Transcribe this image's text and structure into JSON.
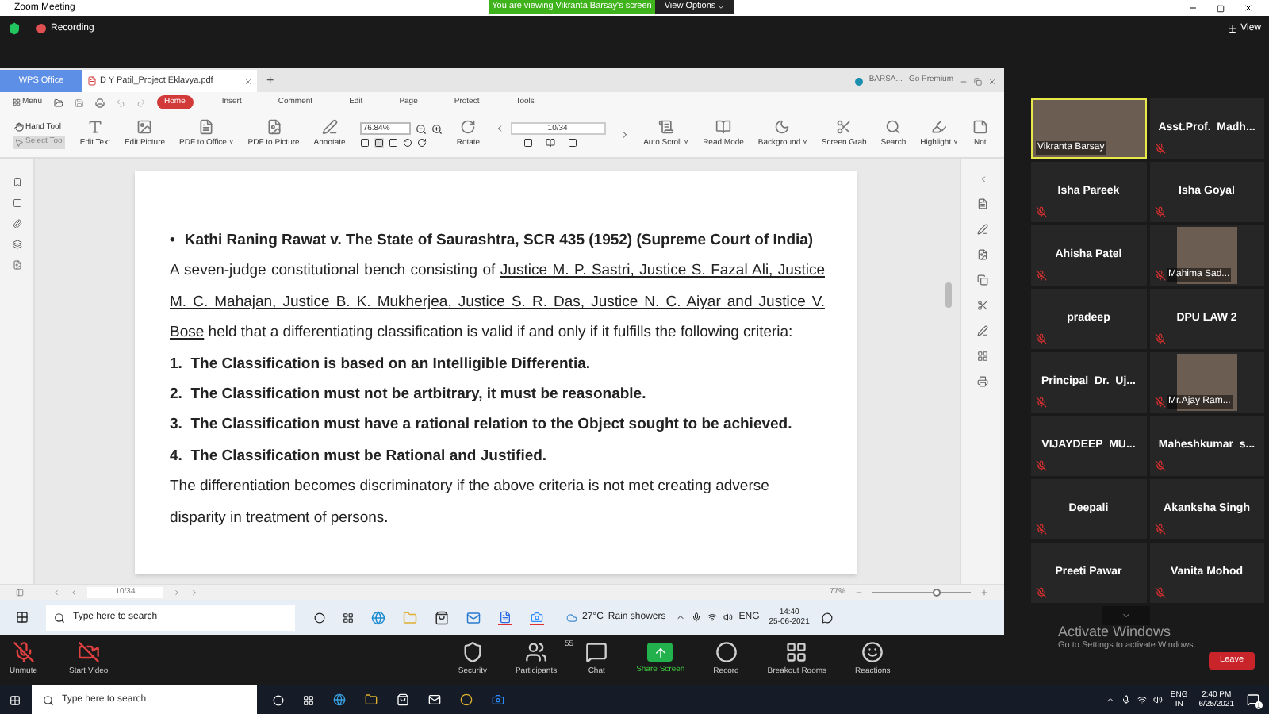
{
  "window": {
    "title": "Zoom Meeting"
  },
  "share_banner": {
    "text": "You are viewing Vikranta Barsay's screen",
    "options": "View Options"
  },
  "top_bar": {
    "recording": "Recording",
    "view": "View"
  },
  "wps": {
    "tabs": [
      {
        "label": "WPS Office",
        "selected": false,
        "kind": "home"
      },
      {
        "label": "D Y Patil_Project Eklavya.pdf",
        "selected": true,
        "kind": "doc"
      }
    ],
    "new_tab": "+",
    "user": "BARSA...",
    "premium": "Go Premium",
    "menu": "Menu",
    "menu_tabs": [
      {
        "label": "Home",
        "selected": true
      },
      {
        "label": "Insert",
        "selected": false
      },
      {
        "label": "Comment",
        "selected": false
      },
      {
        "label": "Edit",
        "selected": false
      },
      {
        "label": "Page",
        "selected": false
      },
      {
        "label": "Protect",
        "selected": false
      },
      {
        "label": "Tools",
        "selected": false
      }
    ],
    "tools": [
      {
        "label": "Hand Tool",
        "selected": false
      },
      {
        "label": "Select Tool",
        "selected": true
      }
    ],
    "ribbon_left": [
      "Edit Text",
      "Edit Picture",
      "PDF to Office ˅",
      "PDF to Picture",
      "Annotate"
    ],
    "zoom_value": "76.84%",
    "rotate": "Rotate",
    "page_value": "10/34",
    "ribbon_right": [
      "Auto Scroll ˅",
      "Read Mode",
      "Background ˅",
      "Screen Grab",
      "Search",
      "Highlight ˅",
      "Not"
    ],
    "status_page": "10/34",
    "status_zoom": "77%",
    "zoom_slider": {
      "level": 0.65
    }
  },
  "document": {
    "bullet": "•",
    "heading": "Kathi Raning Rawat v. The State of Saurashtra, SCR 435 (1952) (Supreme Court of India)",
    "intro": [
      {
        "text": "A seven-judge constitutional bench consisting of ",
        "underlined": false
      },
      {
        "text": "Justice M. P. Sastri, Justice S. Fazal Ali, Justice M. C. Mahajan, Justice B. K. Mukherjea, Justice S. R. Das, Justice N. C. Aiyar and Justice V. Bose",
        "underlined": true
      },
      {
        "text": " held that a differentiating classification is valid if and only if it fulfills the following criteria:",
        "underlined": false
      }
    ],
    "criteria": [
      {
        "number": "1.",
        "text": "The Classification is based on an Intelligible Differentia."
      },
      {
        "number": "2.",
        "text": "The Classification must not be artbitrary, it must be reasonable."
      },
      {
        "number": "3.",
        "text": "The Classification must have a rational relation to the Object sought to be achieved."
      },
      {
        "number": "4.",
        "text": "The Classification must be Rational and Justified."
      }
    ],
    "conclusion": "The differentiation becomes discriminatory if the above criteria is not met creating adverse disparity in treatment of persons."
  },
  "inner_taskbar": {
    "search": "Type here to search",
    "weather": "27°C",
    "forecast": "Rain showers",
    "lang": "ENG",
    "time": "14:40",
    "date": "25-06-2021"
  },
  "participants": [
    {
      "name": "Vikranta Barsay",
      "kind": "video",
      "muted": false,
      "speaking": true
    },
    {
      "name": "Asst.Prof.  Madh...",
      "kind": "name",
      "muted": true,
      "speaking": false
    },
    {
      "name": "Isha Pareek",
      "kind": "name",
      "muted": true,
      "speaking": false
    },
    {
      "name": "Isha Goyal",
      "kind": "name",
      "muted": true,
      "speaking": false
    },
    {
      "name": "Ahisha Patel",
      "kind": "name",
      "muted": true,
      "speaking": false
    },
    {
      "name": "Mahima Sad...",
      "kind": "video",
      "muted": true,
      "speaking": false
    },
    {
      "name": "pradeep",
      "kind": "name",
      "muted": true,
      "speaking": false
    },
    {
      "name": "DPU LAW 2",
      "kind": "name",
      "muted": true,
      "speaking": false
    },
    {
      "name": "Principal  Dr.  Uj...",
      "kind": "name",
      "muted": true,
      "speaking": false
    },
    {
      "name": "Mr.Ajay Ram...",
      "kind": "video",
      "muted": true,
      "speaking": false
    },
    {
      "name": "VIJAYDEEP  MU...",
      "kind": "name",
      "muted": true,
      "speaking": false
    },
    {
      "name": "Maheshkumar  s...",
      "kind": "name",
      "muted": true,
      "speaking": false
    },
    {
      "name": "Deepali",
      "kind": "name",
      "muted": true,
      "speaking": false
    },
    {
      "name": "Akanksha Singh",
      "kind": "name",
      "muted": true,
      "speaking": false
    },
    {
      "name": "Preeti Pawar",
      "kind": "name",
      "muted": true,
      "speaking": false
    },
    {
      "name": "Vanita Mohod",
      "kind": "name",
      "muted": true,
      "speaking": false
    }
  ],
  "activation": {
    "title": "Activate Windows",
    "text": "Go to Settings to activate Windows."
  },
  "toolbar": {
    "left": [
      {
        "label": "Unmute",
        "kind": "mic"
      },
      {
        "label": "Start Video",
        "kind": "video"
      }
    ],
    "center": [
      {
        "label": "Security",
        "kind": "shield"
      },
      {
        "label": "Participants",
        "kind": "people"
      },
      {
        "label": "Chat",
        "kind": "chat"
      },
      {
        "label": "Share Screen",
        "kind": "share"
      },
      {
        "label": "Record",
        "kind": "record"
      },
      {
        "label": "Breakout Rooms",
        "kind": "rooms"
      },
      {
        "label": "Reactions",
        "kind": "smile"
      }
    ],
    "participant_count": "55",
    "leave": "Leave"
  },
  "taskbar": {
    "search": "Type here to search",
    "lang": "ENG",
    "region": "IN",
    "time": "2:40 PM",
    "date": "6/25/2021",
    "notifications": "1"
  }
}
